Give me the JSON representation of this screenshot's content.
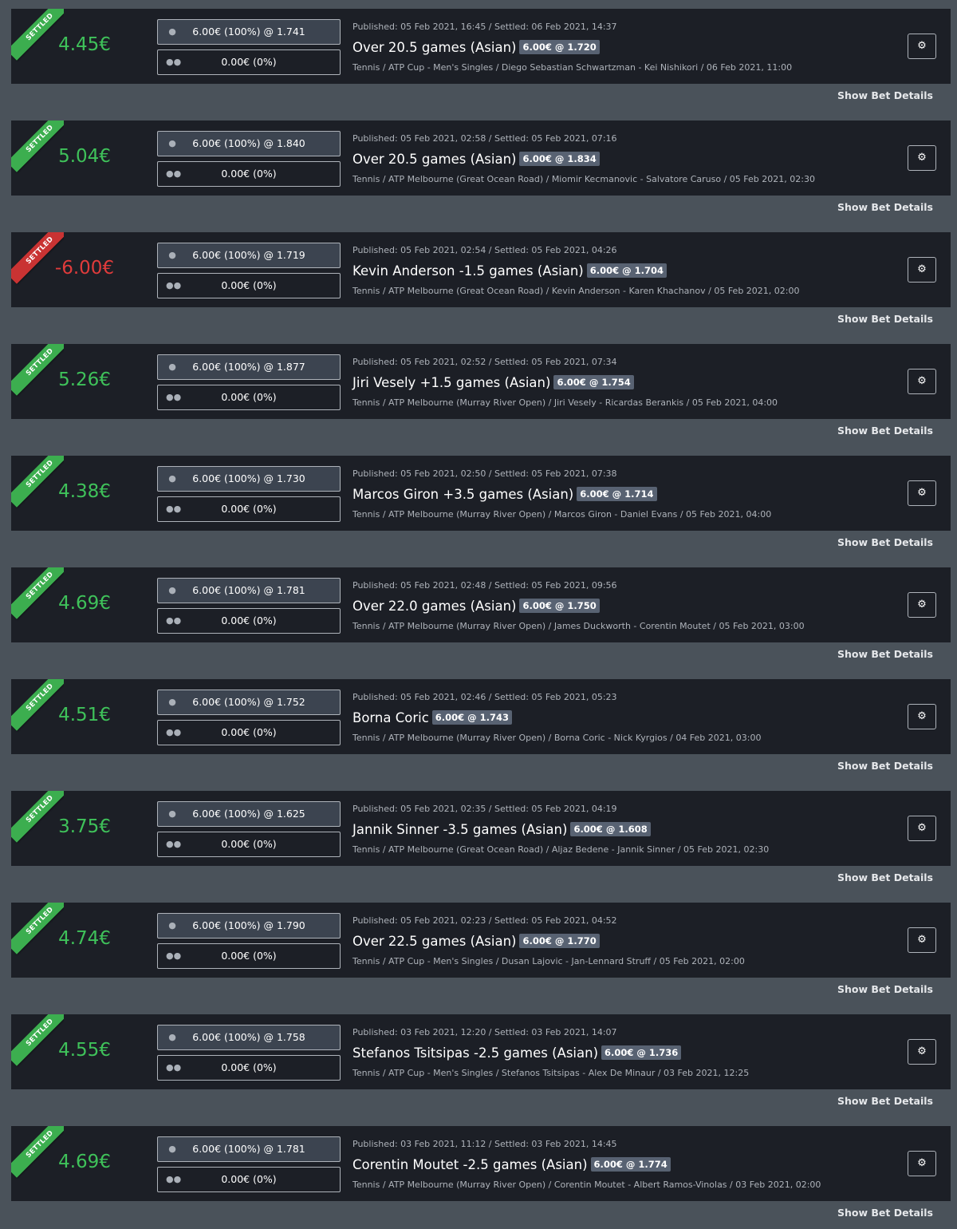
{
  "show_details_label": "Show Bet Details",
  "bets": [
    {
      "status": "SETTLED",
      "result": "win",
      "profit": "4.45€",
      "my_stake": "6.00€ (100%) @ 1.741",
      "crowd_stake": "0.00€ (0%)",
      "meta": "Published: 05 Feb 2021, 16:45 / Settled: 06 Feb 2021, 14:37",
      "selection": "Over 20.5 games (Asian)",
      "odds_badge": "6.00€ @ 1.720",
      "path": "Tennis / ATP Cup - Men's Singles / Diego Sebastian Schwartzman - Kei Nishikori / 06 Feb 2021, 11:00"
    },
    {
      "status": "SETTLED",
      "result": "win",
      "profit": "5.04€",
      "my_stake": "6.00€ (100%) @ 1.840",
      "crowd_stake": "0.00€ (0%)",
      "meta": "Published: 05 Feb 2021, 02:58 / Settled: 05 Feb 2021, 07:16",
      "selection": "Over 20.5 games (Asian)",
      "odds_badge": "6.00€ @ 1.834",
      "path": "Tennis / ATP Melbourne (Great Ocean Road) / Miomir Kecmanovic - Salvatore Caruso / 05 Feb 2021, 02:30"
    },
    {
      "status": "SETTLED",
      "result": "loss",
      "profit": "-6.00€",
      "my_stake": "6.00€ (100%) @ 1.719",
      "crowd_stake": "0.00€ (0%)",
      "meta": "Published: 05 Feb 2021, 02:54 / Settled: 05 Feb 2021, 04:26",
      "selection": "Kevin Anderson -1.5 games (Asian)",
      "odds_badge": "6.00€ @ 1.704",
      "path": "Tennis / ATP Melbourne (Great Ocean Road) / Kevin Anderson - Karen Khachanov / 05 Feb 2021, 02:00"
    },
    {
      "status": "SETTLED",
      "result": "win",
      "profit": "5.26€",
      "my_stake": "6.00€ (100%) @ 1.877",
      "crowd_stake": "0.00€ (0%)",
      "meta": "Published: 05 Feb 2021, 02:52 / Settled: 05 Feb 2021, 07:34",
      "selection": "Jiri Vesely +1.5 games (Asian)",
      "odds_badge": "6.00€ @ 1.754",
      "path": "Tennis / ATP Melbourne (Murray River Open) / Jiri Vesely - Ricardas Berankis / 05 Feb 2021, 04:00"
    },
    {
      "status": "SETTLED",
      "result": "win",
      "profit": "4.38€",
      "my_stake": "6.00€ (100%) @ 1.730",
      "crowd_stake": "0.00€ (0%)",
      "meta": "Published: 05 Feb 2021, 02:50 / Settled: 05 Feb 2021, 07:38",
      "selection": "Marcos Giron +3.5 games (Asian)",
      "odds_badge": "6.00€ @ 1.714",
      "path": "Tennis / ATP Melbourne (Murray River Open) / Marcos Giron - Daniel Evans / 05 Feb 2021, 04:00"
    },
    {
      "status": "SETTLED",
      "result": "win",
      "profit": "4.69€",
      "my_stake": "6.00€ (100%) @ 1.781",
      "crowd_stake": "0.00€ (0%)",
      "meta": "Published: 05 Feb 2021, 02:48 / Settled: 05 Feb 2021, 09:56",
      "selection": "Over 22.0 games (Asian)",
      "odds_badge": "6.00€ @ 1.750",
      "path": "Tennis / ATP Melbourne (Murray River Open) / James Duckworth - Corentin Moutet / 05 Feb 2021, 03:00"
    },
    {
      "status": "SETTLED",
      "result": "win",
      "profit": "4.51€",
      "my_stake": "6.00€ (100%) @ 1.752",
      "crowd_stake": "0.00€ (0%)",
      "meta": "Published: 05 Feb 2021, 02:46 / Settled: 05 Feb 2021, 05:23",
      "selection": "Borna Coric",
      "odds_badge": "6.00€ @ 1.743",
      "path": "Tennis / ATP Melbourne (Murray River Open) / Borna Coric - Nick Kyrgios / 04 Feb 2021, 03:00"
    },
    {
      "status": "SETTLED",
      "result": "win",
      "profit": "3.75€",
      "my_stake": "6.00€ (100%) @ 1.625",
      "crowd_stake": "0.00€ (0%)",
      "meta": "Published: 05 Feb 2021, 02:35 / Settled: 05 Feb 2021, 04:19",
      "selection": "Jannik Sinner -3.5 games (Asian)",
      "odds_badge": "6.00€ @ 1.608",
      "path": "Tennis / ATP Melbourne (Great Ocean Road) / Aljaz Bedene - Jannik Sinner / 05 Feb 2021, 02:30"
    },
    {
      "status": "SETTLED",
      "result": "win",
      "profit": "4.74€",
      "my_stake": "6.00€ (100%) @ 1.790",
      "crowd_stake": "0.00€ (0%)",
      "meta": "Published: 05 Feb 2021, 02:23 / Settled: 05 Feb 2021, 04:52",
      "selection": "Over 22.5 games (Asian)",
      "odds_badge": "6.00€ @ 1.770",
      "path": "Tennis / ATP Cup - Men's Singles / Dusan Lajovic - Jan-Lennard Struff / 05 Feb 2021, 02:00"
    },
    {
      "status": "SETTLED",
      "result": "win",
      "profit": "4.55€",
      "my_stake": "6.00€ (100%) @ 1.758",
      "crowd_stake": "0.00€ (0%)",
      "meta": "Published: 03 Feb 2021, 12:20 / Settled: 03 Feb 2021, 14:07",
      "selection": "Stefanos Tsitsipas -2.5 games (Asian)",
      "odds_badge": "6.00€ @ 1.736",
      "path": "Tennis / ATP Cup - Men's Singles / Stefanos Tsitsipas - Alex De Minaur / 03 Feb 2021, 12:25"
    },
    {
      "status": "SETTLED",
      "result": "win",
      "profit": "4.69€",
      "my_stake": "6.00€ (100%) @ 1.781",
      "crowd_stake": "0.00€ (0%)",
      "meta": "Published: 03 Feb 2021, 11:12 / Settled: 03 Feb 2021, 14:45",
      "selection": "Corentin Moutet -2.5 games (Asian)",
      "odds_badge": "6.00€ @ 1.774",
      "path": "Tennis / ATP Melbourne (Murray River Open) / Corentin Moutet - Albert Ramos-Vinolas / 03 Feb 2021, 02:00"
    }
  ]
}
